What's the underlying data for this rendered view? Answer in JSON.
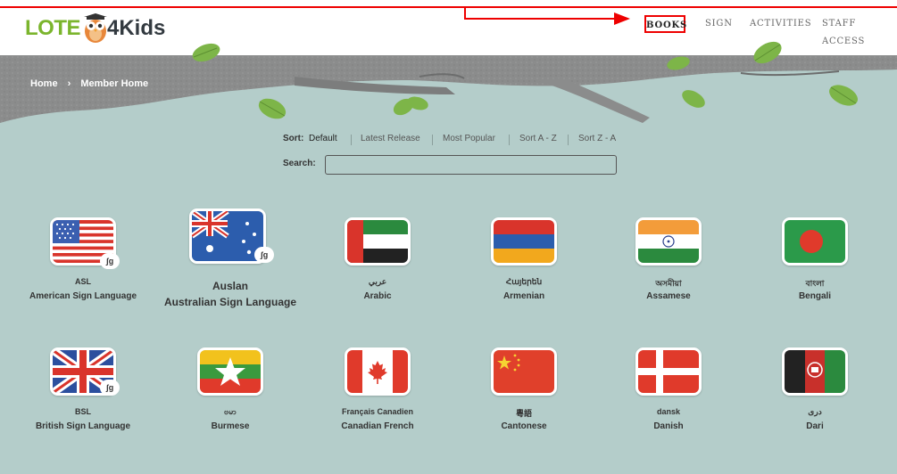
{
  "logo": {
    "part1": "LOTE",
    "part2": "4Kids"
  },
  "nav": {
    "books": "BOOKS",
    "sign": "SIGN",
    "activities": "ACTIVITIES",
    "staff": "STAFF ACCESS"
  },
  "breadcrumb": {
    "home": "Home",
    "separator": "›",
    "current": "Member Home"
  },
  "sort": {
    "label": "Sort:",
    "options": [
      "Default",
      "Latest Release",
      "Most Popular",
      "Sort A - Z",
      "Sort Z - A"
    ]
  },
  "search": {
    "label": "Search:",
    "value": "",
    "placeholder": ""
  },
  "languages": [
    {
      "native": "ASL",
      "english": "American Sign Language",
      "flag": "usa",
      "sign_badge": true
    },
    {
      "native": "Auslan",
      "english": "Australian Sign Language",
      "flag": "australia",
      "sign_badge": true
    },
    {
      "native": "عربي",
      "english": "Arabic",
      "flag": "uae",
      "sign_badge": false
    },
    {
      "native": "Հայերեն",
      "english": "Armenian",
      "flag": "armenia",
      "sign_badge": false
    },
    {
      "native": "অসমীয়া",
      "english": "Assamese",
      "flag": "india",
      "sign_badge": false
    },
    {
      "native": "বাংলা",
      "english": "Bengali",
      "flag": "bangladesh",
      "sign_badge": false
    },
    {
      "native": "BSL",
      "english": "British Sign Language",
      "flag": "uk",
      "sign_badge": true
    },
    {
      "native": "ဗမာ",
      "english": "Burmese",
      "flag": "myanmar",
      "sign_badge": false
    },
    {
      "native": "Français Canadien",
      "english": "Canadian French",
      "flag": "canada",
      "sign_badge": false
    },
    {
      "native": "粵語",
      "english": "Cantonese",
      "flag": "china",
      "sign_badge": false
    },
    {
      "native": "dansk",
      "english": "Danish",
      "flag": "denmark",
      "sign_badge": false
    },
    {
      "native": "دری",
      "english": "Dari",
      "flag": "afghanistan",
      "sign_badge": false
    }
  ],
  "sign_badge_text": "ʃg",
  "colors": {
    "background": "#b4cdca",
    "header": "#ffffff",
    "logo_green": "#7bb52d",
    "annotation_red": "#ee0000",
    "branch": "#8b8c8c",
    "leaf": "#7db548"
  }
}
